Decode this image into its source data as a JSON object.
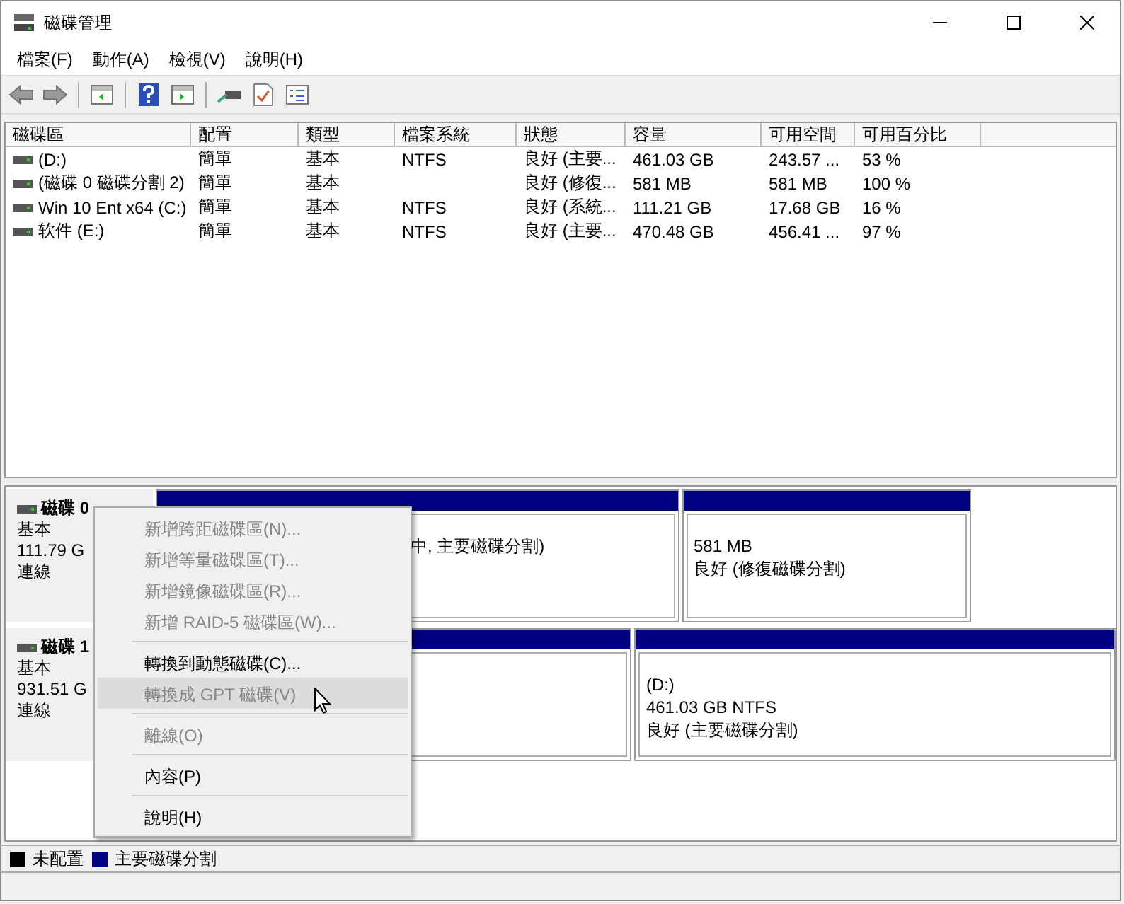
{
  "window": {
    "title": "磁碟管理"
  },
  "menu": [
    "檔案(F)",
    "動作(A)",
    "檢視(V)",
    "說明(H)"
  ],
  "table": {
    "columns": [
      "磁碟區",
      "配置",
      "類型",
      "檔案系統",
      "狀態",
      "容量",
      "可用空間",
      "可用百分比"
    ],
    "rows": [
      [
        "(D:)",
        "簡單",
        "基本",
        "NTFS",
        "良好 (主要...",
        "461.03 GB",
        "243.57 ...",
        "53 %"
      ],
      [
        "(磁碟 0 磁碟分割 2)",
        "簡單",
        "基本",
        "",
        "良好 (修復...",
        "581 MB",
        "581 MB",
        "100 %"
      ],
      [
        "Win 10 Ent x64 (C:)",
        "簡單",
        "基本",
        "NTFS",
        "良好 (系統...",
        "111.21 GB",
        "17.68 GB",
        "16 %"
      ],
      [
        "软件 (E:)",
        "簡單",
        "基本",
        "NTFS",
        "良好 (主要...",
        "470.48 GB",
        "456.41 ...",
        "97 %"
      ]
    ]
  },
  "disks": [
    {
      "name": "磁碟 0",
      "type": "基本",
      "size": "111.79 G",
      "status": "連線",
      "partitions": [
        {
          "kind": "primary",
          "lines": [
            "中, 主要磁碟分割)"
          ]
        },
        {
          "kind": "primary",
          "lines": [
            "581 MB",
            "良好 (修復磁碟分割)"
          ]
        }
      ]
    },
    {
      "name": "磁碟 1",
      "type": "基本",
      "size": "931.51 G",
      "status": "連線",
      "partitions": [
        {
          "kind": "primary"
        },
        {
          "kind": "primary",
          "lines": [
            "(D:)",
            "461.03 GB NTFS",
            "良好 (主要磁碟分割)"
          ]
        }
      ]
    }
  ],
  "legend": [
    {
      "label": "未配置",
      "color": "#000000"
    },
    {
      "label": "主要磁碟分割",
      "color": "#000080"
    }
  ],
  "context_menu": [
    {
      "kind": "item",
      "label": "新增跨距磁碟區(N)...",
      "disabled": true,
      "selected": false
    },
    {
      "kind": "item",
      "label": "新增等量磁碟區(T)...",
      "disabled": true,
      "selected": false
    },
    {
      "kind": "item",
      "label": "新增鏡像磁碟區(R)...",
      "disabled": true,
      "selected": false
    },
    {
      "kind": "item",
      "label": "新增 RAID-5 磁碟區(W)...",
      "disabled": true,
      "selected": false
    },
    {
      "kind": "separator"
    },
    {
      "kind": "item",
      "label": "轉換到動態磁碟(C)...",
      "disabled": false,
      "selected": false
    },
    {
      "kind": "item",
      "label": "轉換成 GPT 磁碟(V)",
      "disabled": true,
      "selected": true
    },
    {
      "kind": "separator"
    },
    {
      "kind": "item",
      "label": "離線(O)",
      "disabled": true,
      "selected": false
    },
    {
      "kind": "separator"
    },
    {
      "kind": "item",
      "label": "內容(P)",
      "disabled": false,
      "selected": false
    },
    {
      "kind": "separator"
    },
    {
      "kind": "item",
      "label": "說明(H)",
      "disabled": false,
      "selected": false
    }
  ]
}
